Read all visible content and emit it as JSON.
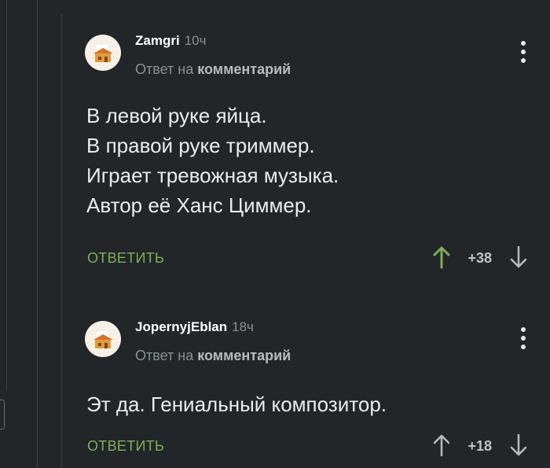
{
  "comments": [
    {
      "author": "Zamgri",
      "time": "10ч",
      "reply_prefix": "Ответ на",
      "reply_target": "комментарий",
      "lines": [
        "В левой руке яйца.",
        "В правой руке триммер.",
        "Играет тревожная музыка.",
        "Автор её Ханс Циммер."
      ],
      "reply_label": "ОТВЕТИТЬ",
      "score": "+38",
      "upvoted": true
    },
    {
      "author": "JopernyjEblan",
      "time": "18ч",
      "reply_prefix": "Ответ на",
      "reply_target": "комментарий",
      "lines": [
        "Эт да. Гениальный композитор."
      ],
      "reply_label": "ОТВЕТИТЬ",
      "score": "+18",
      "upvoted": false
    }
  ],
  "colors": {
    "background": "#222628",
    "accent_green": "#7fae5b",
    "muted": "#8b9093"
  }
}
